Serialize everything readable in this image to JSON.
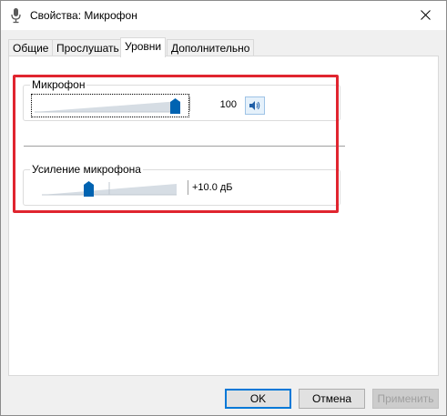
{
  "window": {
    "title": "Свойства: Микрофон",
    "icons": {
      "app": "microphone-icon",
      "close": "close-icon"
    }
  },
  "tabs": [
    {
      "label": "Общие",
      "active": false
    },
    {
      "label": "Прослушать",
      "active": false
    },
    {
      "label": "Уровни",
      "active": true
    },
    {
      "label": "Дополнительно",
      "active": false
    }
  ],
  "levels": {
    "microphone": {
      "label": "Микрофон",
      "value": 100,
      "value_text": "100",
      "mute_icon": "speaker-icon"
    },
    "boost": {
      "label": "Усиление микрофона",
      "value_db": 10.0,
      "value_text": "+10.0 дБ",
      "range_db": [
        0,
        30
      ]
    }
  },
  "buttons": {
    "ok": "OK",
    "cancel": "Отмена",
    "apply": "Применить"
  },
  "colors": {
    "highlight": "#e0252f",
    "slider_thumb": "#0063b1",
    "ramp": "#d6dde4"
  }
}
